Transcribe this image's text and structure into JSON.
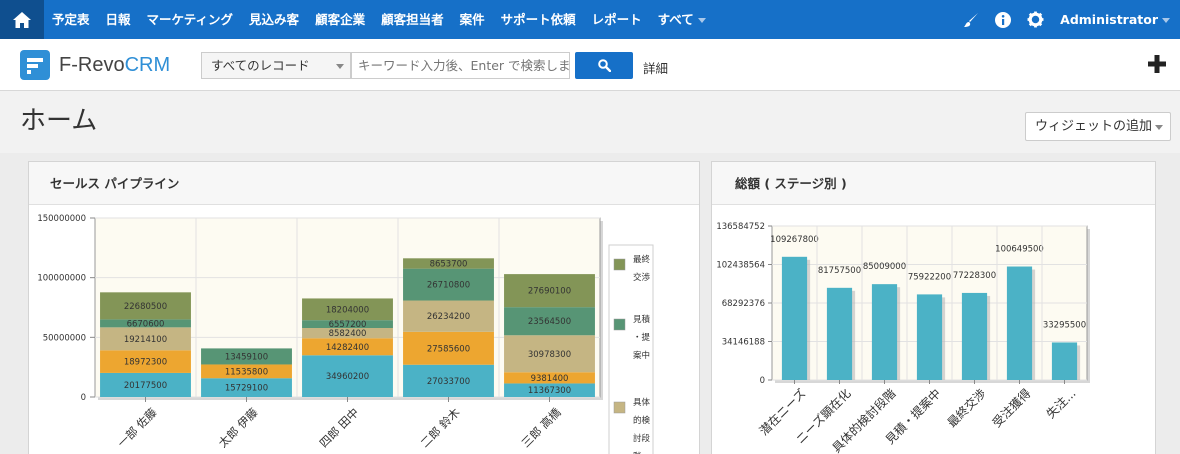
{
  "topnav": {
    "home_icon": "home-icon",
    "items": [
      "予定表",
      "日報",
      "マーケティング",
      "見込み客",
      "顧客企業",
      "顧客担当者",
      "案件",
      "サポート依頼",
      "レポート",
      "すべて"
    ],
    "admin_label": "Administrator",
    "icons": [
      "brush-icon",
      "info-icon",
      "gear-icon"
    ]
  },
  "subbar": {
    "logo_main": "F-Revo",
    "logo_accent": "CRM",
    "record_select": "すべてのレコード",
    "search_placeholder": "キーワード入力後、Enter で検索します",
    "detail_link": "詳細"
  },
  "page": {
    "title": "ホーム",
    "add_widget": "ウィジェットの追加"
  },
  "widgets": {
    "pipeline_title": "セールス パイプライン",
    "amount_title": "総額 ( ステージ別 )"
  },
  "colors": {
    "nav": "#1670c8",
    "plot_bg": "#fdfbf2",
    "seg": [
      "#4bb2c6",
      "#eda630",
      "#c5b583",
      "#579575",
      "#839557"
    ],
    "bar": "#4bb2c6"
  },
  "chart_data": [
    {
      "type": "bar",
      "stacked": true,
      "categories": [
        "一部 佐藤",
        "太郎 伊藤",
        "四郎 田中",
        "二郎 鈴木",
        "三郎 高橋"
      ],
      "series": [
        {
          "values": [
            20177500,
            15729100,
            34960200,
            27033700,
            11367300
          ]
        },
        {
          "values": [
            18972300,
            11535800,
            14282400,
            27585600,
            9381400
          ]
        },
        {
          "values": [
            19214100,
            0,
            8582400,
            26234200,
            30978300
          ]
        },
        {
          "values": [
            6670600,
            13459100,
            6557200,
            26710800,
            23564500
          ]
        },
        {
          "values": [
            22680500,
            0,
            18204000,
            8653700,
            27690100
          ]
        }
      ],
      "y_ticks": [
        "0",
        "50000000",
        "100000000",
        "150000000"
      ],
      "ylim": [
        0,
        150000000
      ],
      "legend_labels": [
        "最終交渉",
        "見積・提案中",
        "具体的検討段階"
      ],
      "legend_placement": "right",
      "grid": true
    },
    {
      "type": "bar",
      "categories": [
        "潜在ニーズ",
        "ニーズ顕在化",
        "具体的検討段階",
        "見積・提案中",
        "最終交渉",
        "受注獲得",
        "失注..."
      ],
      "values": [
        109267800,
        81757500,
        85009000,
        75922200,
        77228300,
        100649500,
        33295500
      ],
      "y_ticks": [
        "0",
        "34146188",
        "68292376",
        "102438564",
        "136584752"
      ],
      "ylim": [
        0,
        136584752
      ],
      "grid": true
    }
  ]
}
